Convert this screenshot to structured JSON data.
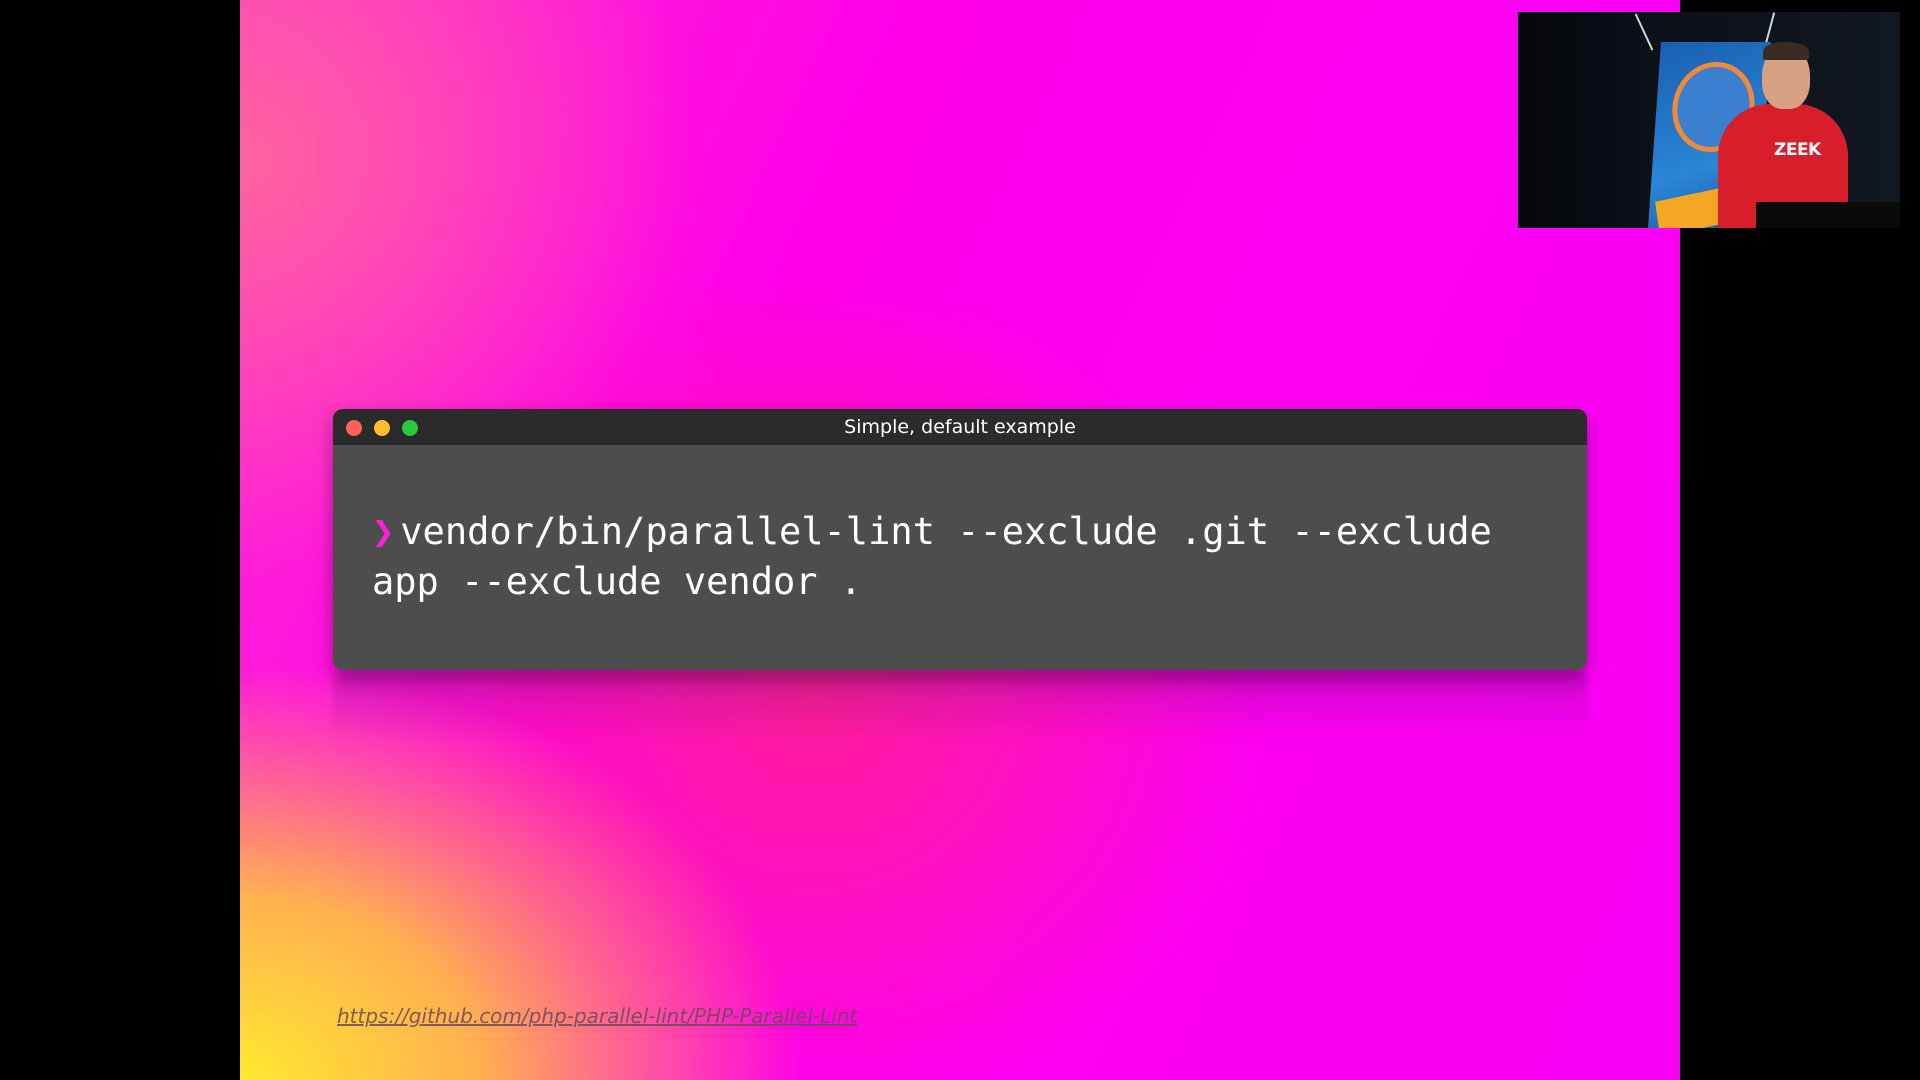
{
  "terminal": {
    "title": "Simple, default example",
    "prompt_symbol": "❯",
    "command_line_1": "vendor/bin/parallel-lint --exclude .git --exclude",
    "command_line_2": "app --exclude vendor ."
  },
  "footer": {
    "link_text": "https://github.com/php-parallel-lint/PHP-Parallel-Lint"
  },
  "webcam": {
    "shirt_text": "ZEEK"
  },
  "colors": {
    "prompt": "#ff1fd9",
    "terminal_bg": "#4d4d4d",
    "titlebar_bg": "#2b2b2b",
    "close": "#ff5f57",
    "minimize": "#febc2e",
    "maximize": "#28c840"
  }
}
